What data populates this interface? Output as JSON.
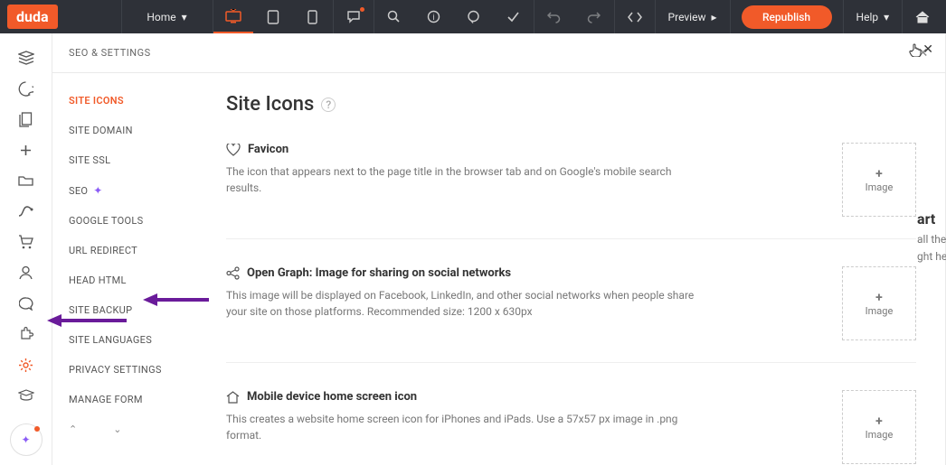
{
  "topbar": {
    "logo": "duda",
    "page_selector": "Home",
    "preview_label": "Preview",
    "republish_label": "Republish",
    "help_label": "Help"
  },
  "panel": {
    "header": "SEO & SETTINGS"
  },
  "subnav": {
    "items": [
      "SITE ICONS",
      "SITE DOMAIN",
      "SITE SSL",
      "SEO",
      "GOOGLE TOOLS",
      "URL REDIRECT",
      "HEAD HTML",
      "SITE BACKUP",
      "SITE LANGUAGES",
      "PRIVACY SETTINGS",
      "MANAGE FORM"
    ]
  },
  "content": {
    "title": "Site Icons",
    "sections": [
      {
        "title": "Favicon",
        "desc": "The icon that appears next to the page title in the browser tab and on Google's mobile search results.",
        "upload": "Image"
      },
      {
        "title": "Open Graph: Image for sharing on social networks",
        "desc": "This image will be displayed on Facebook, LinkedIn, and other social networks when people share your site on those platforms. Recommended size: 1200 x 630px",
        "upload": "Image"
      },
      {
        "title": "Mobile device home screen icon",
        "desc": "This creates a website home screen icon for iPhones and iPads. Use a 57x57 px image in .png format.",
        "upload": "Image"
      }
    ]
  },
  "behind": {
    "line1": "art",
    "line2": "all the",
    "line3": "ght here."
  }
}
